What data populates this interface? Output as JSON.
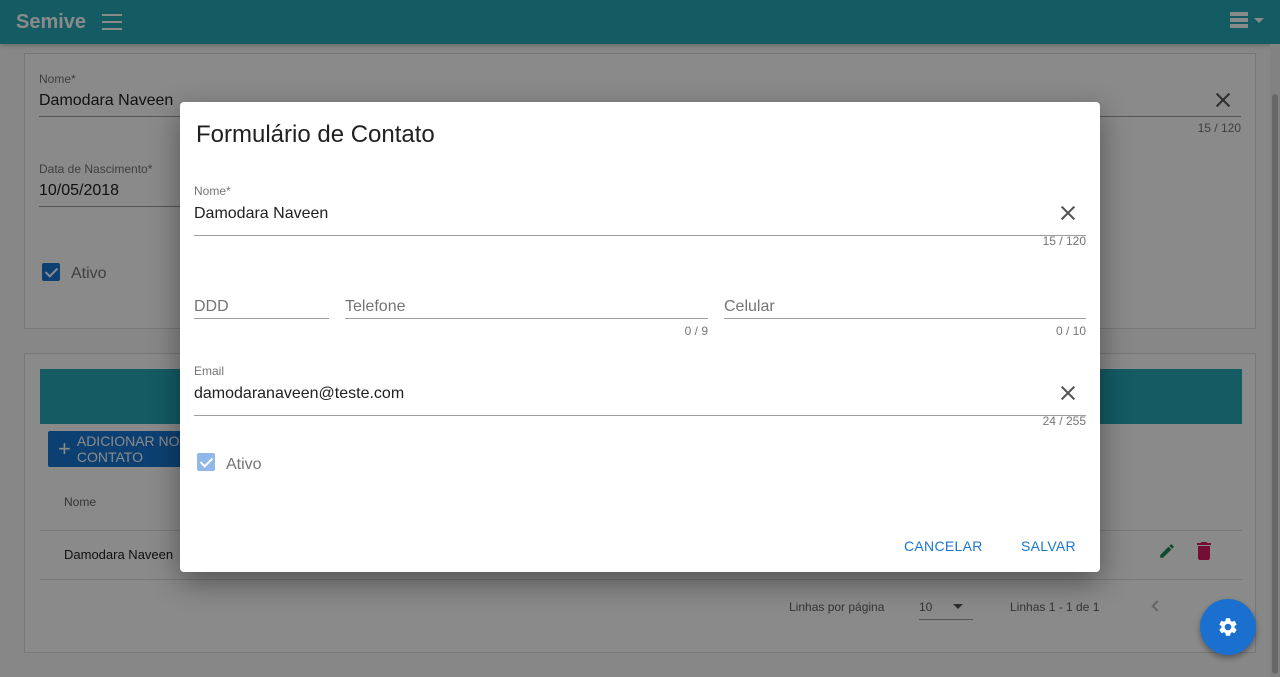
{
  "app": {
    "brand": "Semive"
  },
  "background": {
    "nome_label": "Nome*",
    "nome_value": "Damodara Naveen",
    "nome_counter": "15 / 120",
    "nascimento_label": "Data de Nascimento*",
    "nascimento_value": "10/05/2018",
    "ativo_label": "Ativo",
    "add_button_label": "ADICIONAR NOVO CONTATO",
    "table_header_nome": "Nome",
    "table_rows": [
      {
        "nome": "Damodara Naveen"
      }
    ],
    "pager": {
      "rows_label": "Linhas por página",
      "rows_value": "10",
      "range_label": "Linhas 1 - 1 de 1"
    }
  },
  "dialog": {
    "title": "Formulário de Contato",
    "nome": {
      "label": "Nome*",
      "value": "Damodara Naveen",
      "counter": "15 / 120"
    },
    "ddd": {
      "placeholder": "DDD"
    },
    "telefone": {
      "placeholder": "Telefone",
      "counter": "0 / 9"
    },
    "celular": {
      "placeholder": "Celular",
      "counter": "0 / 10"
    },
    "email": {
      "label": "Email",
      "value": "damodaranaveen@teste.com",
      "counter": "24 / 255"
    },
    "ativo_label": "Ativo",
    "cancel_label": "CANCELAR",
    "save_label": "SALVAR"
  },
  "colors": {
    "header": "#26a9b8",
    "primary": "#1976d2",
    "edit": "#1b8a5a",
    "delete": "#d81b60"
  }
}
